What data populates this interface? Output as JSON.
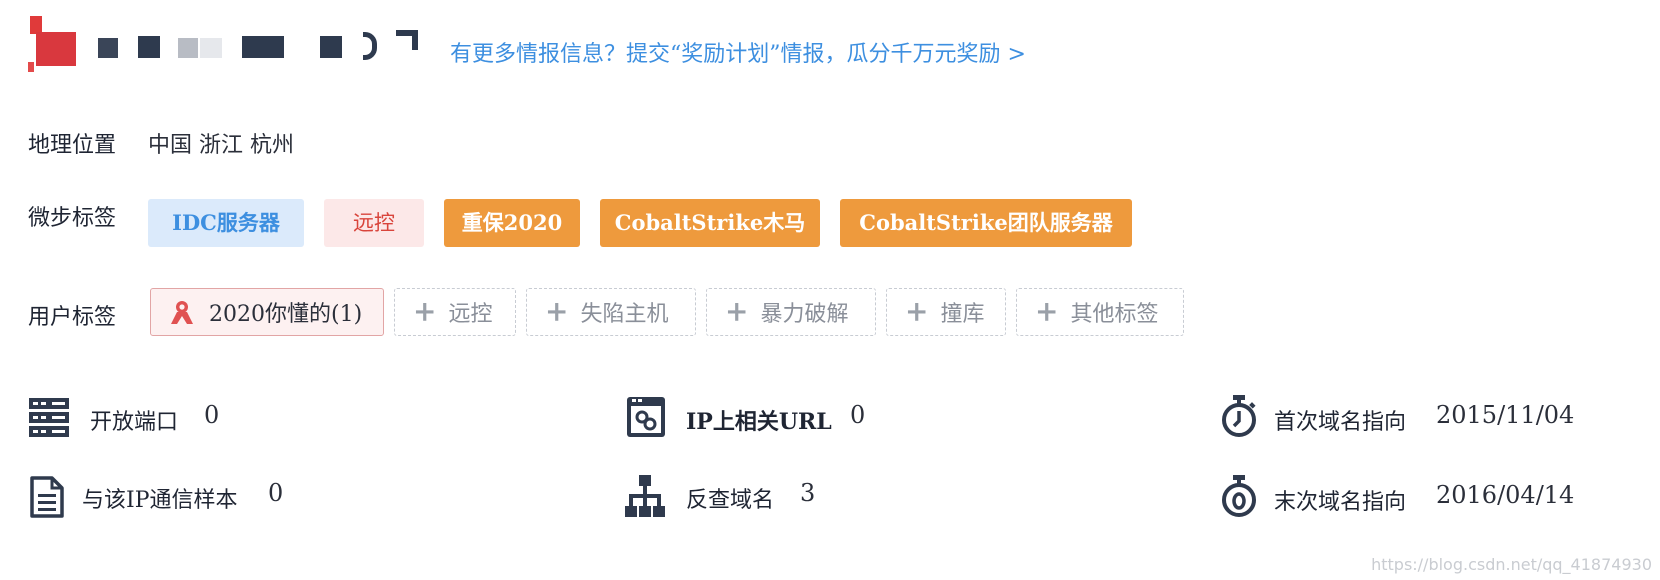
{
  "header": {
    "promo_link": "有更多情报信息？提交“奖励计划”情报，瓜分千万元奖励 >"
  },
  "location": {
    "label": "地理位置",
    "value": "中国 浙江 杭州"
  },
  "threat_tags": {
    "label": "微步标签",
    "items": [
      {
        "text": "IDC服务器",
        "style": "blue"
      },
      {
        "text": "远控",
        "style": "pink"
      },
      {
        "text": "重保2020",
        "style": "orange"
      },
      {
        "text": "CobaltStrike木马",
        "style": "orange"
      },
      {
        "text": "CobaltStrike团队服务器",
        "style": "orange"
      }
    ]
  },
  "user_tags": {
    "label": "用户标签",
    "owned": "2020你懂的(1)",
    "suggestions": [
      "远控",
      "失陷主机",
      "暴力破解",
      "撞库",
      "其他标签"
    ]
  },
  "stats": {
    "open_ports": {
      "label": "开放端口",
      "value": "0",
      "icon": "server-icon"
    },
    "related_urls": {
      "label": "IP上相关URL",
      "value": "0",
      "icon": "link-window-icon"
    },
    "first_resolve": {
      "label": "首次域名指向",
      "value": "2015/11/04",
      "icon": "stopwatch-icon"
    },
    "samples": {
      "label": "与该IP通信样本",
      "value": "0",
      "icon": "document-icon"
    },
    "reverse_domains": {
      "label": "反查域名",
      "value": "3",
      "icon": "hierarchy-icon"
    },
    "last_resolve": {
      "label": "末次域名指向",
      "value": "2016/04/14",
      "icon": "stopwatch-zero-icon"
    }
  },
  "watermark": "https://blog.csdn.net/qq_41874930",
  "colors": {
    "link": "#3d8fe0",
    "tag_blue_bg": "#dbeafb",
    "tag_pink_bg": "#fce8e8",
    "tag_orange_bg": "#ee9a3d",
    "icon_dark": "#2f3a4d"
  }
}
